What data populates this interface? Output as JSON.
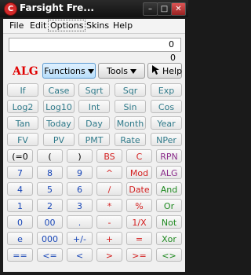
{
  "window": {
    "title": "Farsight Fre...",
    "app_icon": "C",
    "min_label": "–",
    "max_label": "□",
    "close_label": "✕"
  },
  "menu": {
    "items": [
      "File",
      "Edit",
      "Options",
      "Skins",
      "Help"
    ],
    "selected": "Options"
  },
  "display": {
    "line1": "0",
    "line2": "0"
  },
  "mode": "ALG",
  "toolbar": {
    "functions": "Functions",
    "tools": "Tools",
    "help": "Help"
  },
  "colors": {
    "teal": "#2f7a8a",
    "black": "#000000",
    "blue": "#1947b8",
    "red": "#d42020",
    "green": "#1f8a20",
    "purple": "#8b2d8b",
    "mode": "#e00000"
  },
  "keypad": {
    "rows": [
      [
        {
          "label": "If",
          "color": "teal"
        },
        {
          "label": "Case",
          "color": "teal"
        },
        {
          "label": "Sqrt",
          "color": "teal"
        },
        {
          "label": "Sqr",
          "color": "teal"
        },
        {
          "label": "Exp",
          "color": "teal"
        }
      ],
      [
        {
          "label": "Log2",
          "color": "teal"
        },
        {
          "label": "Log10",
          "color": "teal"
        },
        {
          "label": "Int",
          "color": "teal"
        },
        {
          "label": "Sin",
          "color": "teal"
        },
        {
          "label": "Cos",
          "color": "teal"
        }
      ],
      [
        {
          "label": "Tan",
          "color": "teal"
        },
        {
          "label": "Today",
          "color": "teal"
        },
        {
          "label": "Day",
          "color": "teal"
        },
        {
          "label": "Month",
          "color": "teal"
        },
        {
          "label": "Year",
          "color": "teal"
        }
      ],
      [
        {
          "label": "FV",
          "color": "teal"
        },
        {
          "label": "PV",
          "color": "teal"
        },
        {
          "label": "PMT",
          "color": "teal"
        },
        {
          "label": "Rate",
          "color": "teal"
        },
        {
          "label": "NPer",
          "color": "teal"
        }
      ],
      [
        {
          "label": "(=0",
          "color": "black"
        },
        {
          "label": "(",
          "color": "black"
        },
        {
          "label": ")",
          "color": "black"
        },
        {
          "label": "BS",
          "color": "red"
        },
        {
          "label": "C",
          "color": "red"
        },
        {
          "label": "RPN",
          "color": "purple"
        }
      ],
      [
        {
          "label": "7",
          "color": "blue"
        },
        {
          "label": "8",
          "color": "blue"
        },
        {
          "label": "9",
          "color": "blue"
        },
        {
          "label": "^",
          "color": "red"
        },
        {
          "label": "Mod",
          "color": "red"
        },
        {
          "label": "ALG",
          "color": "purple"
        }
      ],
      [
        {
          "label": "4",
          "color": "blue"
        },
        {
          "label": "5",
          "color": "blue"
        },
        {
          "label": "6",
          "color": "blue"
        },
        {
          "label": "/",
          "color": "red"
        },
        {
          "label": "Date",
          "color": "red"
        },
        {
          "label": "And",
          "color": "green"
        }
      ],
      [
        {
          "label": "1",
          "color": "blue"
        },
        {
          "label": "2",
          "color": "blue"
        },
        {
          "label": "3",
          "color": "blue"
        },
        {
          "label": "*",
          "color": "red"
        },
        {
          "label": "%",
          "color": "red"
        },
        {
          "label": "Or",
          "color": "green"
        }
      ],
      [
        {
          "label": "0",
          "color": "blue"
        },
        {
          "label": "00",
          "color": "blue"
        },
        {
          "label": ".",
          "color": "blue"
        },
        {
          "label": "-",
          "color": "red"
        },
        {
          "label": "1/X",
          "color": "red"
        },
        {
          "label": "Not",
          "color": "green"
        }
      ],
      [
        {
          "label": "e",
          "color": "blue"
        },
        {
          "label": "000",
          "color": "blue"
        },
        {
          "label": "+/-",
          "color": "blue"
        },
        {
          "label": "+",
          "color": "red"
        },
        {
          "label": "=",
          "color": "red"
        },
        {
          "label": "Xor",
          "color": "green"
        }
      ],
      [
        {
          "label": "==",
          "color": "blue"
        },
        {
          "label": "<=",
          "color": "blue"
        },
        {
          "label": "<",
          "color": "blue"
        },
        {
          "label": ">",
          "color": "red"
        },
        {
          "label": ">=",
          "color": "red"
        },
        {
          "label": "<>",
          "color": "green"
        }
      ]
    ]
  }
}
